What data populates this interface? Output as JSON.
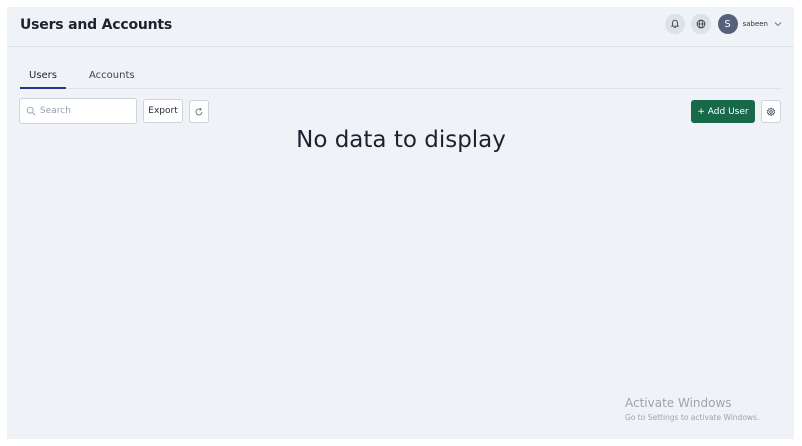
{
  "header": {
    "title": "Users and Accounts",
    "avatar_initial": "S",
    "username": "sabeen",
    "icons": [
      "bell-icon",
      "globe-icon",
      "chevron-down-icon"
    ]
  },
  "tabs": [
    {
      "label": "Users",
      "active": true
    },
    {
      "label": "Accounts",
      "active": false
    }
  ],
  "toolbar": {
    "search_placeholder": "Search",
    "search_value": "",
    "export_label": "Export",
    "add_user_label": "+ Add User"
  },
  "main": {
    "empty_message": "No data to display"
  },
  "watermark": {
    "title": "Activate Windows",
    "subtitle": "Go to Settings to activate Windows."
  },
  "colors": {
    "accent": "#17694a",
    "tab_underline": "#1f3a8a",
    "background": "#eff3f7"
  }
}
